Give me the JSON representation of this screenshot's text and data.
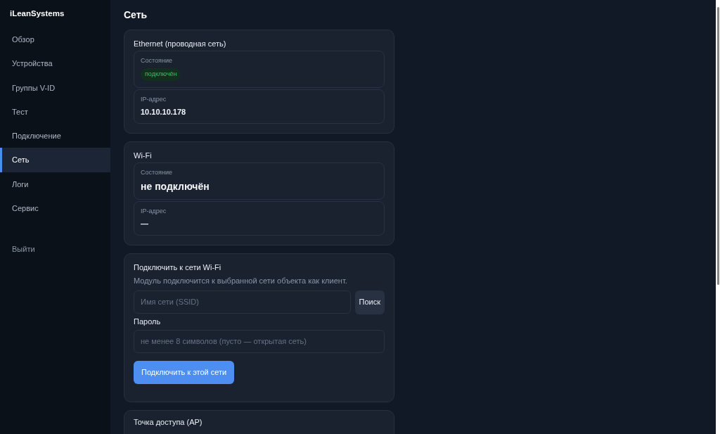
{
  "sidebar": {
    "brand": "iLeanSystems",
    "items": [
      {
        "label": "Обзор",
        "selected": false
      },
      {
        "label": "Устройства",
        "selected": false
      },
      {
        "label": "Группы V-ID",
        "selected": false
      },
      {
        "label": "Тест",
        "selected": false
      },
      {
        "label": "Подключение",
        "selected": false
      },
      {
        "label": "Сеть",
        "selected": true
      },
      {
        "label": "Логи",
        "selected": false
      },
      {
        "label": "Сервис",
        "selected": false
      }
    ],
    "logout": "Выйти"
  },
  "page_title": "Сеть",
  "status_cards": [
    {
      "title": "Ethernet (проводная сеть)",
      "fields": [
        {
          "label": "Состояние",
          "value": "подключён",
          "kind": "badge"
        },
        {
          "label": "IP-адрес",
          "value": "10.10.10.178",
          "kind": "text"
        }
      ]
    },
    {
      "title": "Wi-Fi",
      "fields": [
        {
          "label": "Состояние",
          "value": "не подключён",
          "kind": "large"
        },
        {
          "label": "IP-адрес",
          "value": "—",
          "kind": "text"
        }
      ]
    }
  ],
  "connect_card": {
    "title": "Подключить к сети Wi-Fi",
    "description": "Модуль подключится к выбранной сети объекта как клиент.",
    "ssid": {
      "placeholder": "Имя сети (SSID)"
    },
    "search_button": "Поиск",
    "password_label": "Пароль",
    "password": {
      "placeholder": "не менее 8 символов (пусто — открытая сеть)"
    },
    "connect_button": "Подключить к этой сети"
  },
  "ap_card": {
    "title": "Точка доступа (AP)"
  }
}
